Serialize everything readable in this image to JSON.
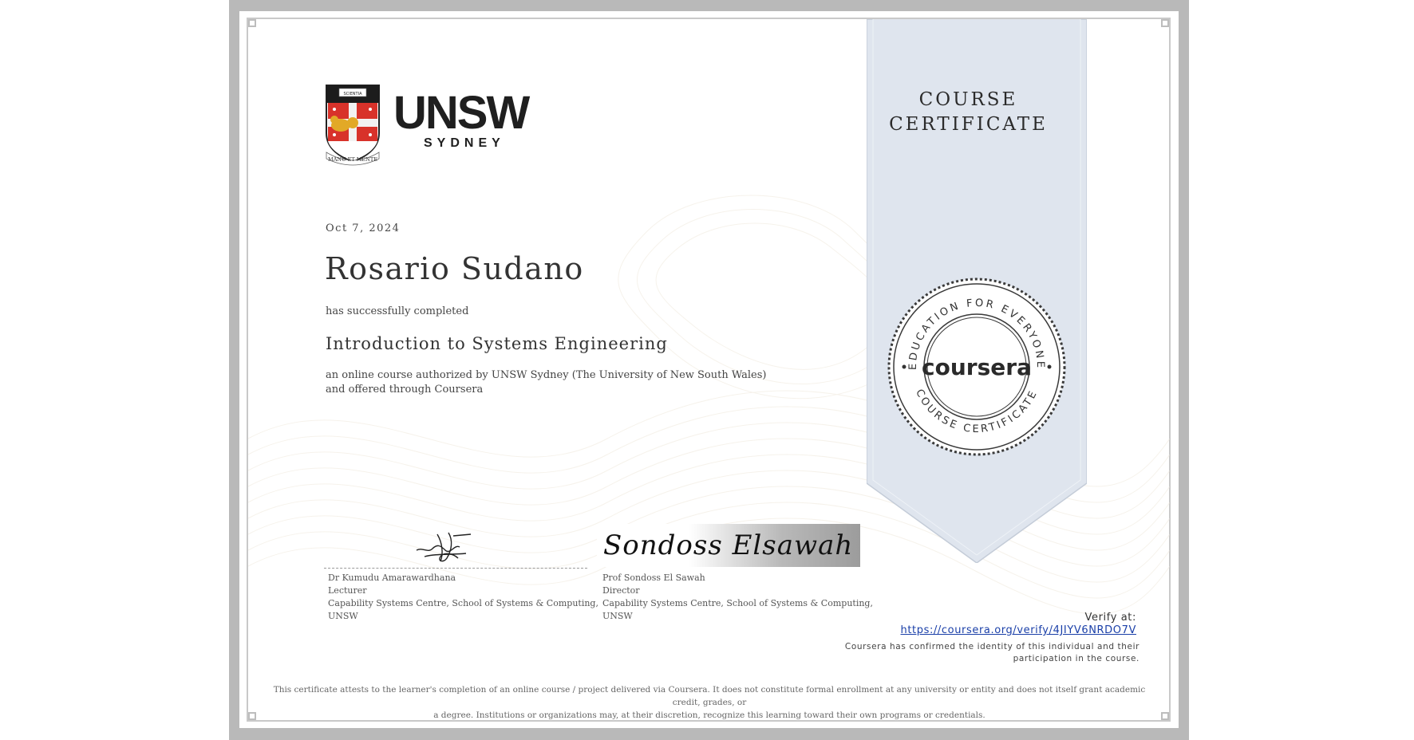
{
  "ribbon": {
    "line1": "COURSE",
    "line2": "CERTIFICATE"
  },
  "issuer": {
    "logo_name": "UNSW",
    "logo_sub": "SYDNEY",
    "crest_scroll_top": "SCIENTIA",
    "crest_motto": "MANU ET MENTE"
  },
  "certificate": {
    "date": "Oct 7, 2024",
    "recipient": "Rosario Sudano",
    "completed_text": "has successfully completed",
    "course_title": "Introduction to Systems Engineering",
    "description": "an online course authorized by UNSW Sydney (The University of New South Wales) and offered through Coursera"
  },
  "signatories": [
    {
      "name": "Dr Kumudu Amarawardhana",
      "role": "Lecturer",
      "org_line1": "Capability Systems Centre, School of Systems & Computing,",
      "org_line2": "UNSW"
    },
    {
      "name": "Prof Sondoss El Sawah",
      "role": "Director",
      "org_line1": "Capability Systems Centre, School of Systems & Computing,",
      "org_line2": "UNSW"
    }
  ],
  "signature_2_script": "Sondoss Elsawah",
  "seal": {
    "brand": "coursera",
    "ring_top": "EDUCATION FOR EVERYONE",
    "ring_bottom": "COURSE CERTIFICATE"
  },
  "verify": {
    "label": "Verify at:",
    "url": "https://coursera.org/verify/4JIYV6NRDO7V",
    "confirm_line1": "Coursera has confirmed the identity of this individual and their",
    "confirm_line2": "participation in the course."
  },
  "disclaimer": {
    "line1": "This certificate attests to the learner's completion of an online course / project delivered via Coursera. It does not constitute formal enrollment at any university or entity and does not itself grant academic credit, grades, or",
    "line2": "a degree. Institutions or organizations may, at their discretion, recognize this learning toward their own programs or credentials."
  },
  "colors": {
    "ribbon": "#dfe5ee",
    "link": "#1a3fa8",
    "frame": "#b9b9b9",
    "crest_red": "#d8322a"
  }
}
